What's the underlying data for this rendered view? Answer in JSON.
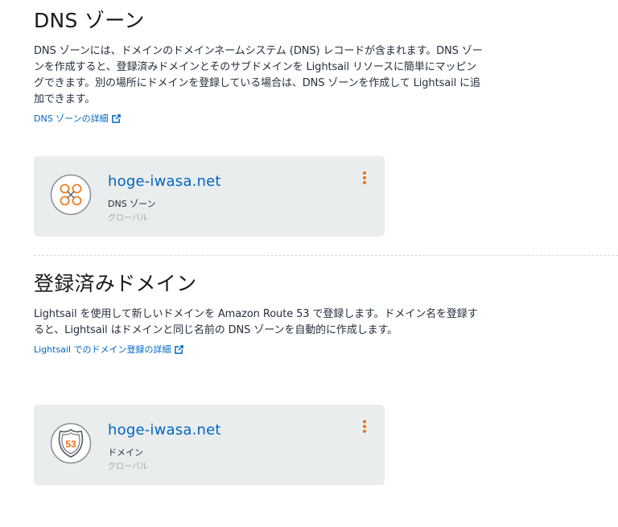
{
  "dns_zones": {
    "title": "DNS ゾーン",
    "description": "DNS ゾーンには、ドメインのドメインネームシステム (DNS) レコードが含まれます。DNS ゾーンを作成すると、登録済みドメインとそのサブドメインを Lightsail リソースに簡単にマッピングできます。別の場所にドメインを登録している場合は、DNS ゾーンを作成して Lightsail に追加できます。",
    "learn_more": "DNS ゾーンの詳細",
    "card": {
      "name": "hoge-iwasa.net",
      "type": "DNS ゾーン",
      "region": "グローバル",
      "icon": "dns-zone-icon"
    }
  },
  "registered_domains": {
    "title": "登録済みドメイン",
    "description": "Lightsail を使用して新しいドメインを Amazon Route 53 で登録します。ドメイン名を登録すると、Lightsail はドメインと同じ名前の DNS ゾーンを自動的に作成します。",
    "learn_more": "Lightsail でのドメイン登録の詳細",
    "card": {
      "name": "hoge-iwasa.net",
      "type": "ドメイン",
      "region": "グローバル",
      "icon": "route53-shield-icon",
      "badge_text": "53"
    }
  },
  "colors": {
    "link": "#0066c0",
    "menu_accent": "#ec7211",
    "card_bg": "#eaeded"
  }
}
